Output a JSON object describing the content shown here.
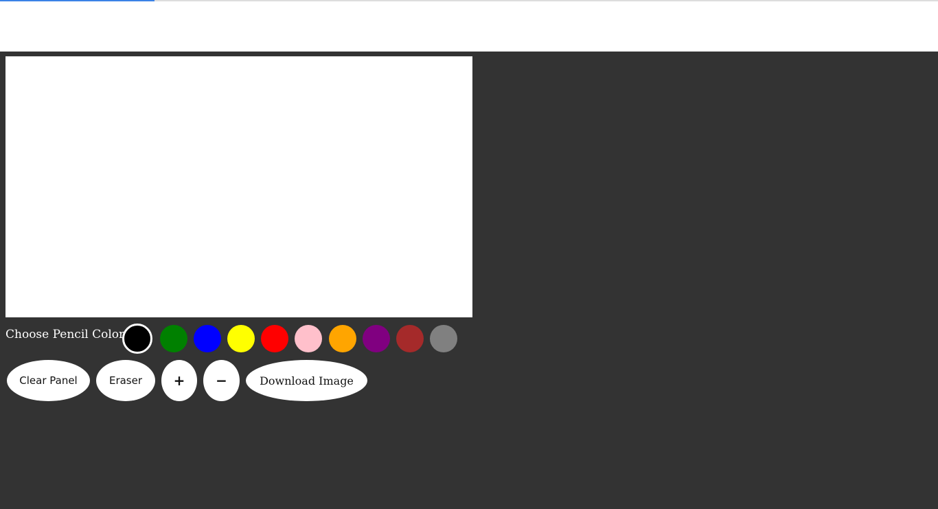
{
  "loading_progress": 0.165,
  "colors": {
    "background": "#333333",
    "canvas": "#ffffff",
    "progress": "#3b82e6"
  },
  "palette": {
    "label": "Choose Pencil Color",
    "swatches": [
      {
        "name": "black",
        "color": "#000000",
        "selected": true
      },
      {
        "name": "green",
        "color": "#008000",
        "selected": false
      },
      {
        "name": "blue",
        "color": "#0000ff",
        "selected": false
      },
      {
        "name": "yellow",
        "color": "#ffff00",
        "selected": false
      },
      {
        "name": "red",
        "color": "#ff0000",
        "selected": false
      },
      {
        "name": "pink",
        "color": "#ffc0cb",
        "selected": false
      },
      {
        "name": "orange",
        "color": "#ffa500",
        "selected": false
      },
      {
        "name": "purple",
        "color": "#800080",
        "selected": false
      },
      {
        "name": "brown",
        "color": "#a52a2a",
        "selected": false
      },
      {
        "name": "gray",
        "color": "#808080",
        "selected": false
      }
    ]
  },
  "toolbar": {
    "clear_label": "Clear Panel",
    "eraser_label": "Eraser",
    "increase_label": "+",
    "decrease_label": "−",
    "download_label": "Download Image"
  }
}
